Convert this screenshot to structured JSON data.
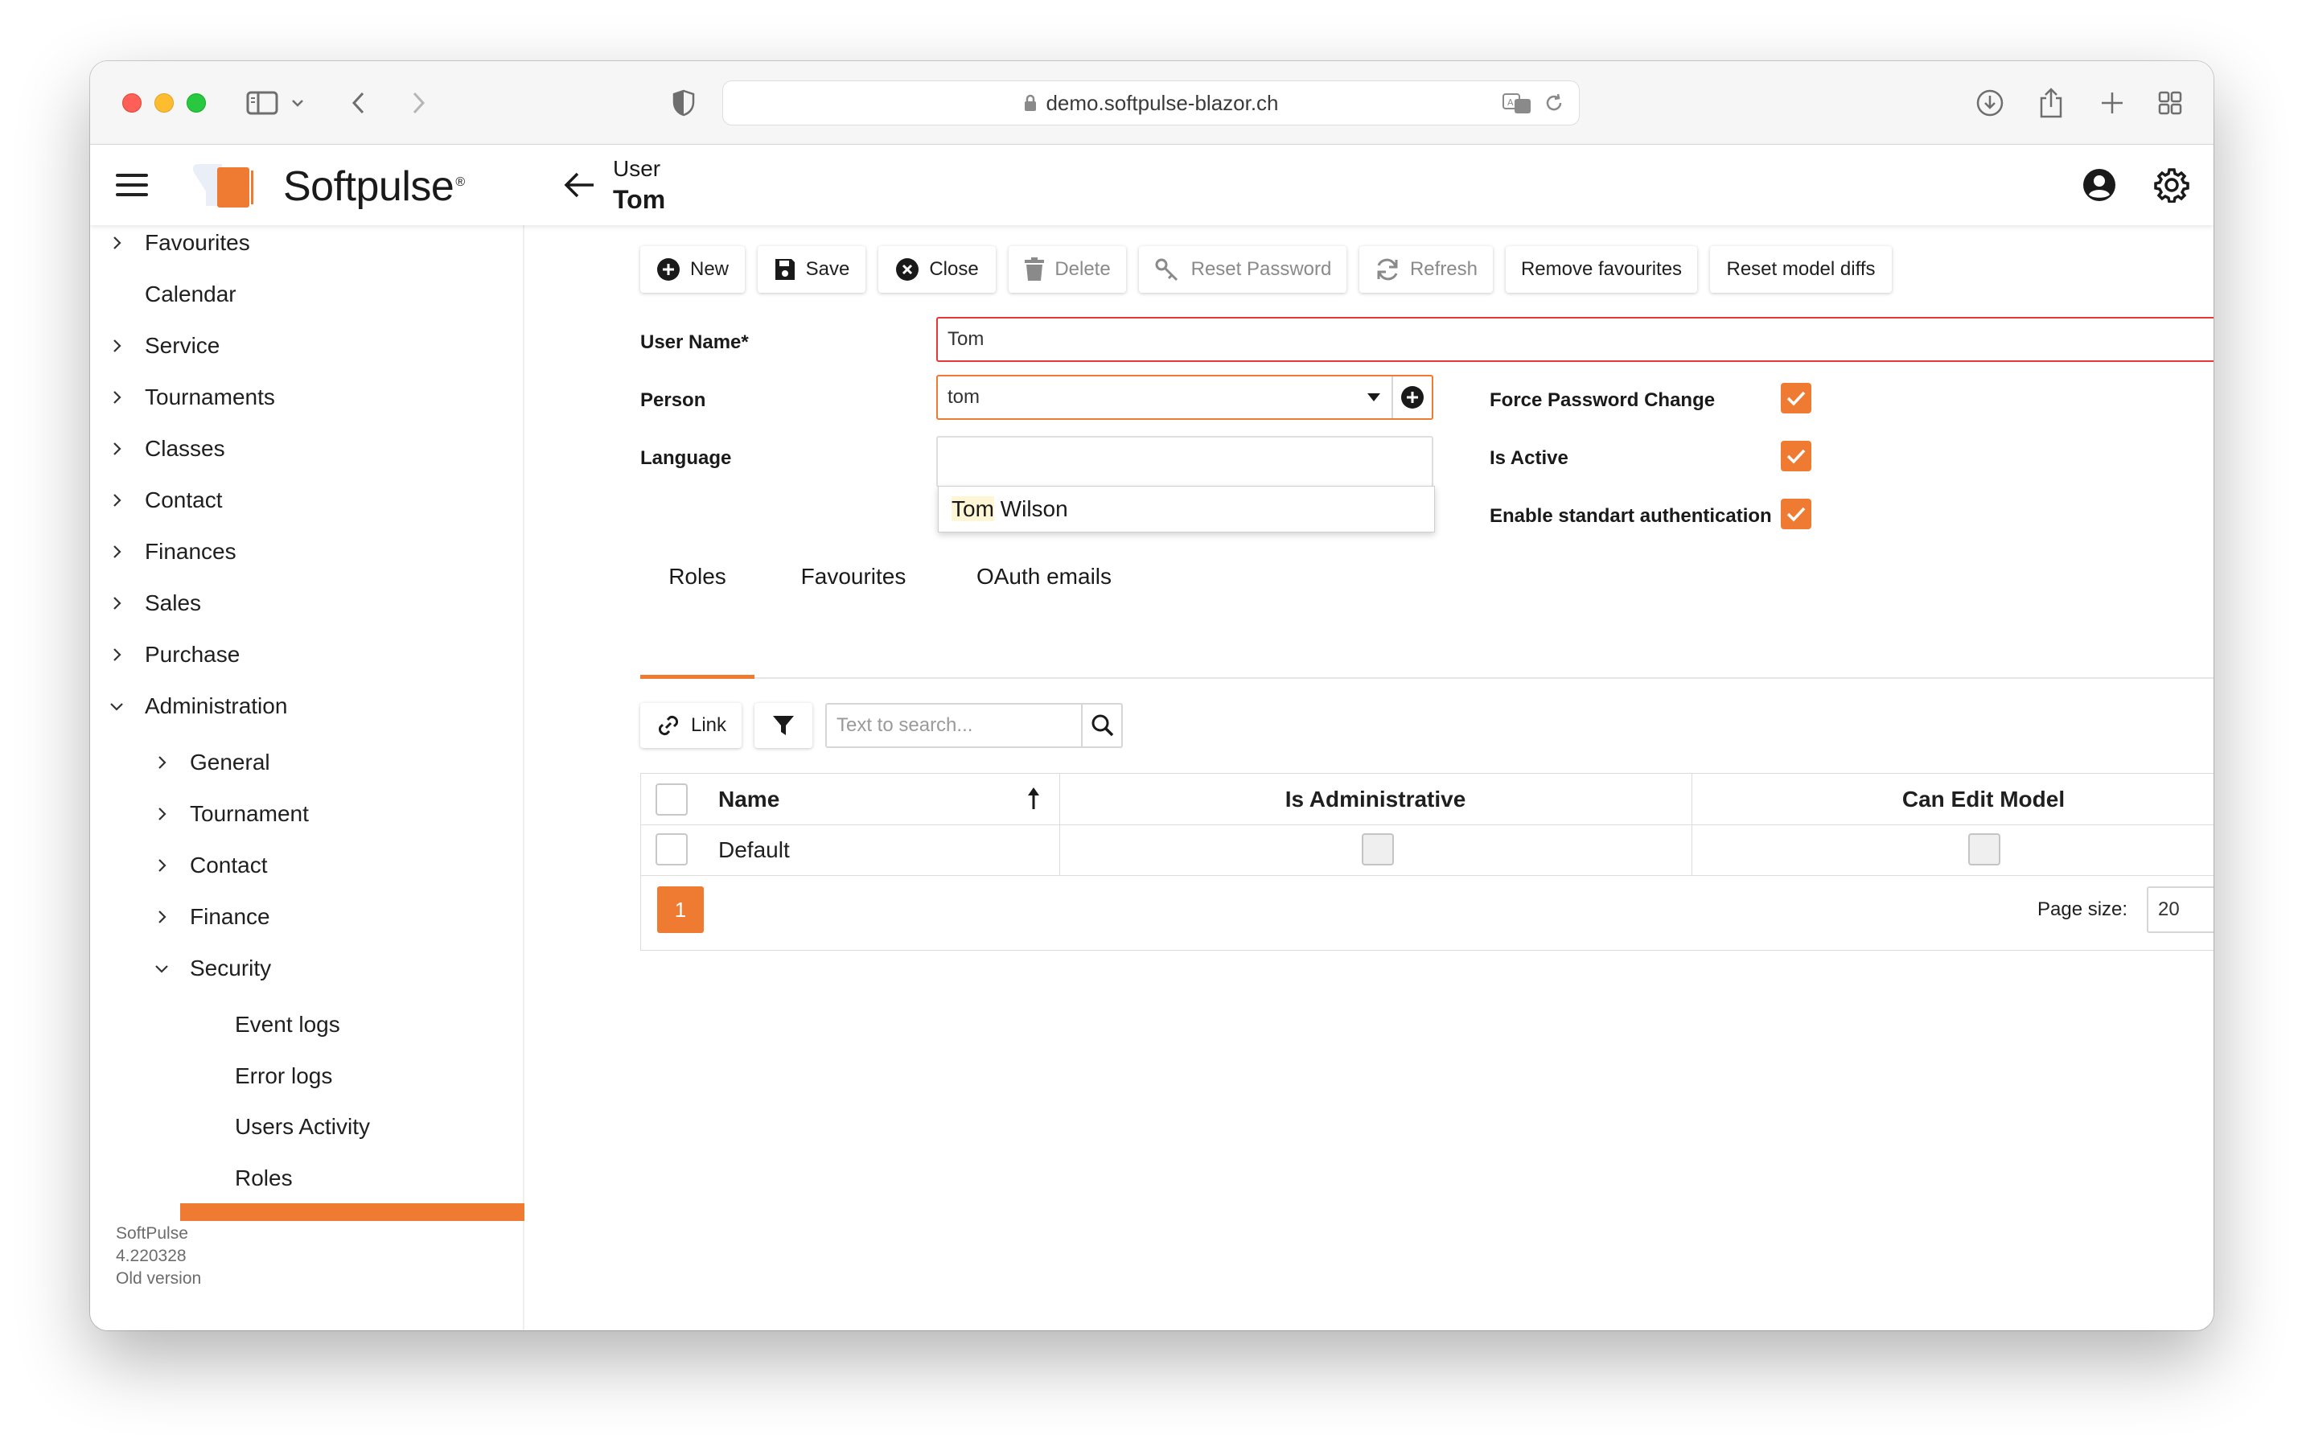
{
  "browser": {
    "url": "demo.softpulse-blazor.ch"
  },
  "header": {
    "logo_text": "Softpulse",
    "logo_mark": "®",
    "subtitle": "User",
    "title": "Tom"
  },
  "sidebar": {
    "items": [
      {
        "label": "Favourites",
        "chevron": "right"
      },
      {
        "label": "Calendar",
        "chevron": "none"
      },
      {
        "label": "Service",
        "chevron": "right"
      },
      {
        "label": "Tournaments",
        "chevron": "right"
      },
      {
        "label": "Classes",
        "chevron": "right"
      },
      {
        "label": "Contact",
        "chevron": "right"
      },
      {
        "label": "Finances",
        "chevron": "right"
      },
      {
        "label": "Sales",
        "chevron": "right"
      },
      {
        "label": "Purchase",
        "chevron": "right"
      },
      {
        "label": "Administration",
        "chevron": "down"
      }
    ],
    "admin_items": [
      {
        "label": "General",
        "chevron": "right"
      },
      {
        "label": "Tournament",
        "chevron": "right"
      },
      {
        "label": "Contact",
        "chevron": "right"
      },
      {
        "label": "Finance",
        "chevron": "right"
      },
      {
        "label": "Security",
        "chevron": "down"
      }
    ],
    "security_items": [
      {
        "label": "Event logs"
      },
      {
        "label": "Error logs"
      },
      {
        "label": "Users Activity"
      },
      {
        "label": "Roles"
      }
    ],
    "footer": {
      "app_name": "SoftPulse",
      "version": "4.220328",
      "old_version_link": "Old version"
    }
  },
  "toolbar": {
    "new": "New",
    "save": "Save",
    "close": "Close",
    "delete": "Delete",
    "reset_password": "Reset Password",
    "refresh": "Refresh",
    "remove_favourites": "Remove favourites",
    "reset_model_diffs": "Reset model diffs"
  },
  "form": {
    "user_name_label": "User Name*",
    "user_name_value": "Tom",
    "person_label": "Person",
    "person_value": "tom",
    "language_label": "Language",
    "person_suggestion_match": "Tom",
    "person_suggestion_rest": " Wilson",
    "force_password_change_label": "Force Password Change",
    "force_password_change": true,
    "is_active_label": "Is Active",
    "is_active": true,
    "enable_standard_auth_label": "Enable standart authentication",
    "enable_standard_auth": true
  },
  "tabs": [
    {
      "label": "Roles",
      "active": true
    },
    {
      "label": "Favourites",
      "active": false
    },
    {
      "label": "OAuth emails",
      "active": false
    }
  ],
  "roles_grid": {
    "link_label": "Link",
    "search_placeholder": "Text to search...",
    "columns": [
      "Name",
      "Is Administrative",
      "Can Edit Model"
    ],
    "rows": [
      {
        "name": "Default",
        "is_administrative": false,
        "can_edit_model": false
      }
    ],
    "current_page": "1",
    "page_size_label": "Page size:",
    "page_size": "20"
  },
  "colors": {
    "accent": "#ef7a31",
    "error_border": "#e53935"
  },
  "icons": [
    "hamburger-icon",
    "back-arrow-icon",
    "user-circle-icon",
    "gear-icon",
    "plus-circle-icon",
    "save-icon",
    "close-circle-icon",
    "trash-icon",
    "key-icon",
    "refresh-icon",
    "link-icon",
    "filter-icon",
    "search-icon",
    "sort-up-icon",
    "caret-down-icon",
    "check-icon",
    "clear-icon"
  ]
}
